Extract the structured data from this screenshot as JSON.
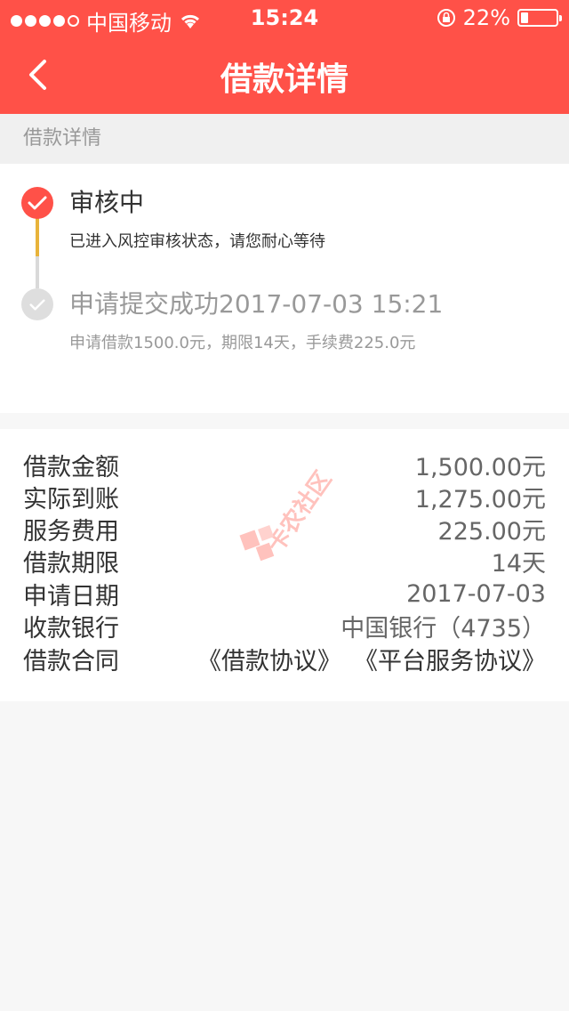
{
  "status_bar": {
    "carrier": "中国移动",
    "time": "15:24",
    "battery": "22%",
    "battery_level": 0.22
  },
  "nav": {
    "title": "借款详情"
  },
  "section": {
    "title": "借款详情"
  },
  "timeline": {
    "items": [
      {
        "title": "审核中",
        "desc": "已进入风控审核状态，请您耐心等待"
      },
      {
        "title": "申请提交成功2017-07-03 15:21",
        "desc": "申请借款1500.0元，期限14天，手续费225.0元"
      }
    ]
  },
  "details": {
    "rows": [
      {
        "label": "借款金额",
        "value": "1,500.00元"
      },
      {
        "label": "实际到账",
        "value": "1,275.00元"
      },
      {
        "label": "服务费用",
        "value": "225.00元"
      },
      {
        "label": "借款期限",
        "value": "14天"
      },
      {
        "label": "申请日期",
        "value": "2017-07-03"
      },
      {
        "label": "收款银行",
        "value": "中国银行（4735）"
      }
    ],
    "contract": {
      "label": "借款合同",
      "link1": "《借款协议》",
      "link2": "《平台服务协议》"
    }
  },
  "watermark_text": "卡农社区",
  "colors": {
    "brand": "#ff5148",
    "progress": "#e8b33a"
  }
}
